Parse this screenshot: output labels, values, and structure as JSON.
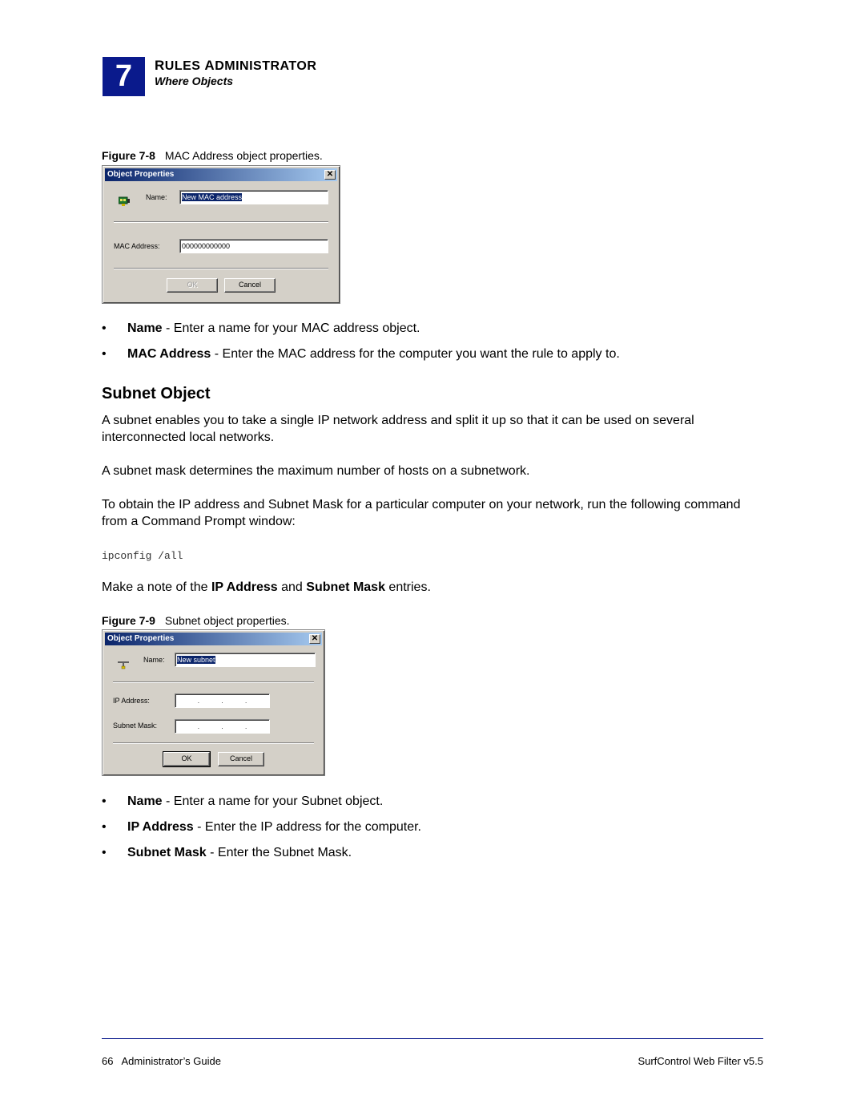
{
  "header": {
    "chapter_number": "7",
    "chapter_title_cap1": "R",
    "chapter_title_rest1": "ULES ",
    "chapter_title_cap2": "A",
    "chapter_title_rest2": "DMINISTRATOR",
    "section": "Where Objects"
  },
  "figure1": {
    "number": "Figure 7-8",
    "caption": "MAC Address object properties.",
    "dialog": {
      "title": "Object Properties",
      "close_label": "✕",
      "icon": "network-card-icon",
      "name_label": "Name:",
      "name_value": "New MAC address",
      "mac_label": "MAC Address:",
      "mac_value": "000000000000",
      "ok_label": "OK",
      "ok_enabled": false,
      "cancel_label": "Cancel"
    }
  },
  "bullets1": [
    {
      "term": "Name",
      "text": " - Enter a name for your MAC address object."
    },
    {
      "term": "MAC Address",
      "text": " - Enter the MAC address for the computer you want the rule to apply to."
    }
  ],
  "section_heading": "Subnet Object",
  "paragraphs": {
    "p1": "A subnet enables you to take a single IP network address and split it up so that it can be used on several interconnected local networks.",
    "p2": "A subnet mask determines the maximum number of hosts on a subnetwork.",
    "p3": "To obtain the IP address and Subnet Mask for a particular computer on your network, run the following command from a Command Prompt window:",
    "code": "ipconfig /all",
    "p4_pre": "Make a note of the ",
    "p4_b1": "IP Address",
    "p4_mid": " and ",
    "p4_b2": "Subnet Mask",
    "p4_post": " entries."
  },
  "figure2": {
    "number": "Figure 7-9",
    "caption": "Subnet object properties.",
    "dialog": {
      "title": "Object Properties",
      "close_label": "✕",
      "icon": "subnet-icon",
      "name_label": "Name:",
      "name_value": "New subnet",
      "ip_label": "IP Address:",
      "mask_label": "Subnet Mask:",
      "ok_label": "OK",
      "cancel_label": "Cancel"
    }
  },
  "bullets2": [
    {
      "term": "Name",
      "text": " - Enter a name for your Subnet object."
    },
    {
      "term": "IP Address",
      "text": " - Enter the IP address for the computer."
    },
    {
      "term": "Subnet Mask",
      "text": " - Enter the Subnet Mask."
    }
  ],
  "bullet_char": "•",
  "footer": {
    "page_number": "66",
    "guide": "Administrator’s Guide",
    "product": "SurfControl Web Filter v5.5"
  }
}
